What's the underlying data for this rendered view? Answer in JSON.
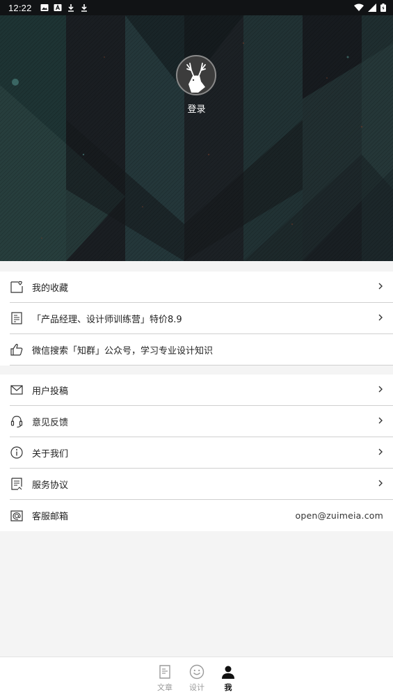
{
  "status_bar": {
    "time": "12:22",
    "left_icons": [
      "image-icon",
      "a-icon",
      "download-icon",
      "download-icon"
    ],
    "right_icons": [
      "wifi-icon",
      "signal-icon",
      "battery-icon"
    ]
  },
  "header": {
    "avatar_icon": "deer-logo-icon",
    "login_label": "登录"
  },
  "menu_group_1": [
    {
      "icon": "favorite-folder-icon",
      "label": "我的收藏",
      "chevron": true
    },
    {
      "icon": "document-icon",
      "label": "「产品经理、设计师训练营」特价8.9",
      "chevron": true
    },
    {
      "icon": "thumbs-up-icon",
      "label": "微信搜索「知群」公众号，学习专业设计知识",
      "chevron": false
    }
  ],
  "menu_group_2": [
    {
      "icon": "mail-icon",
      "label": "用户投稿",
      "chevron": true
    },
    {
      "icon": "headset-icon",
      "label": "意见反馈",
      "chevron": true
    },
    {
      "icon": "info-icon",
      "label": "关于我们",
      "chevron": true
    },
    {
      "icon": "agreement-icon",
      "label": "服务协议",
      "chevron": true
    },
    {
      "icon": "email-at-icon",
      "label": "客服邮箱",
      "value": "open@zuimeia.com",
      "chevron": false
    }
  ],
  "bottom_nav": {
    "tabs": [
      {
        "icon": "article-icon",
        "label": "文章",
        "active": false
      },
      {
        "icon": "smiley-icon",
        "label": "设计",
        "active": false
      },
      {
        "icon": "person-icon",
        "label": "我",
        "active": true
      }
    ]
  },
  "colors": {
    "status_bar": "#111315",
    "banner_base": "#1d2125",
    "banner_teal": "#1f3a3a",
    "background": "#f4f4f4",
    "divider": "#cfcfcf",
    "active_tab": "#111111",
    "inactive_tab": "#9a9a9a"
  }
}
